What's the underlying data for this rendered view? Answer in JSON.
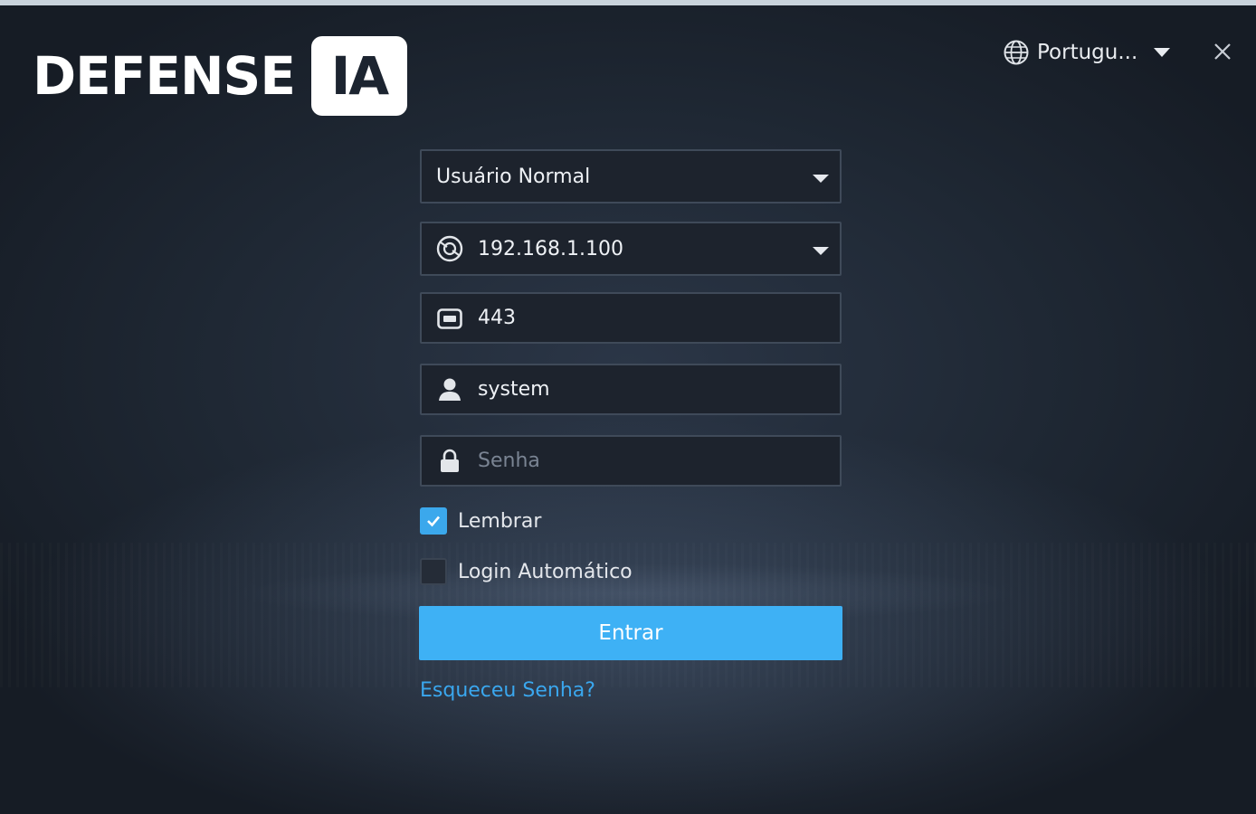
{
  "header": {
    "logo_text": "DEFENSE",
    "logo_badge": "IA",
    "language": {
      "label": "Portugu...",
      "icon": "globe-icon"
    },
    "close_icon": "close-icon"
  },
  "form": {
    "user_type": {
      "value": "Usuário Normal"
    },
    "server": {
      "value": "192.168.1.100",
      "icon": "server-icon"
    },
    "port": {
      "value": "443",
      "icon": "port-icon"
    },
    "username": {
      "value": "system",
      "icon": "user-icon"
    },
    "password": {
      "placeholder": "Senha",
      "value": "",
      "icon": "lock-icon"
    },
    "remember": {
      "label": "Lembrar",
      "checked": true
    },
    "auto_login": {
      "label": "Login Automático",
      "checked": false
    },
    "submit_label": "Entrar",
    "forgot_link": "Esqueceu Senha?"
  },
  "colors": {
    "accent": "#3eb1f5",
    "link": "#3aa7ee",
    "background": "#1f2834",
    "field_bg": "#1d232d",
    "field_border": "#3f4a59"
  }
}
